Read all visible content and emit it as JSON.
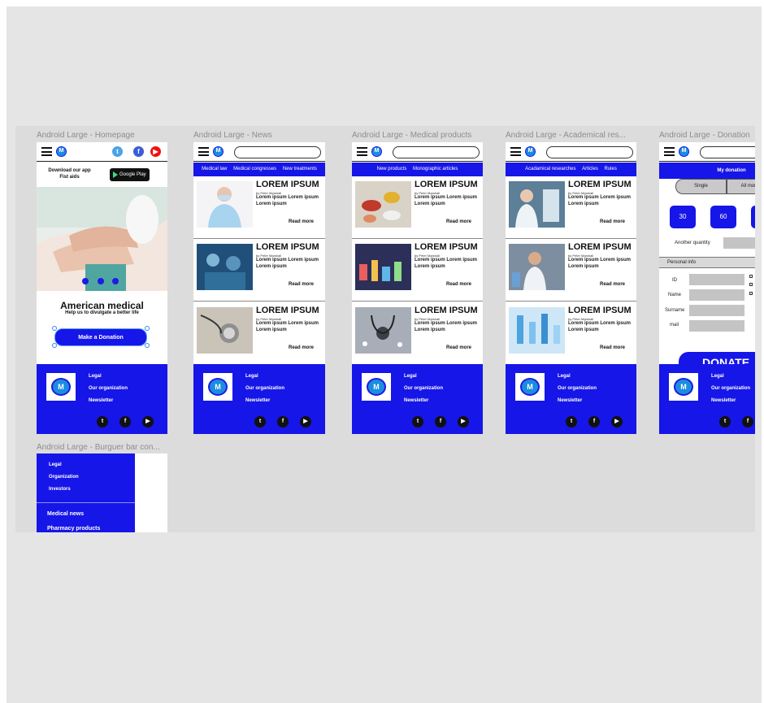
{
  "frames": {
    "homepage": {
      "label": "Android Large - Homepage",
      "download": "Download our app\nFist aids",
      "store_badge": "Google Play",
      "title": "American medical",
      "subtitle": "Help us to divulgate a better life",
      "donate_button": "Make a Donation"
    },
    "news": {
      "label": "Android Large - News",
      "tabs": [
        "Medical law",
        "Medical congresses",
        "New treatments"
      ]
    },
    "products": {
      "label": "Android Large - Medical products",
      "tabs": [
        "New products",
        "Monographic articles"
      ]
    },
    "academic": {
      "label": "Android Large - Academical res...",
      "tabs": [
        "Acadamical researches",
        "Articles",
        "Rules"
      ]
    },
    "donation": {
      "label": "Android Large - Donation",
      "header": "My donation",
      "segments": [
        "Single",
        "All month"
      ],
      "amounts": [
        "30",
        "60"
      ],
      "another_quantity": "Another quantity",
      "personal_info": "Personal info",
      "fields": [
        "ID",
        "Name",
        "Surname",
        "mail"
      ],
      "donate": "DONATE"
    },
    "burger": {
      "label": "Android Large - Burguer bar con...",
      "items_small": [
        "Legal",
        "Organization",
        "Investors"
      ],
      "items_big": [
        "Medical news",
        "Pharmacy products"
      ]
    }
  },
  "article": {
    "title": "LOREM IPSUM",
    "byline": "by Peter Marshall",
    "body": "Lorem ipsum Lorem ipsum Lorem ipsum",
    "read_more": "Read more"
  },
  "footer": {
    "links": [
      "Legal",
      "Our organization",
      "Newsletter"
    ]
  },
  "colors": {
    "brand_blue": "#1616e8",
    "logo_blue": "#1c8ce0",
    "canvas": "#e5e5e5"
  },
  "icons": [
    "hamburger-icon",
    "logo-icon",
    "twitter-icon",
    "facebook-icon",
    "youtube-icon"
  ]
}
